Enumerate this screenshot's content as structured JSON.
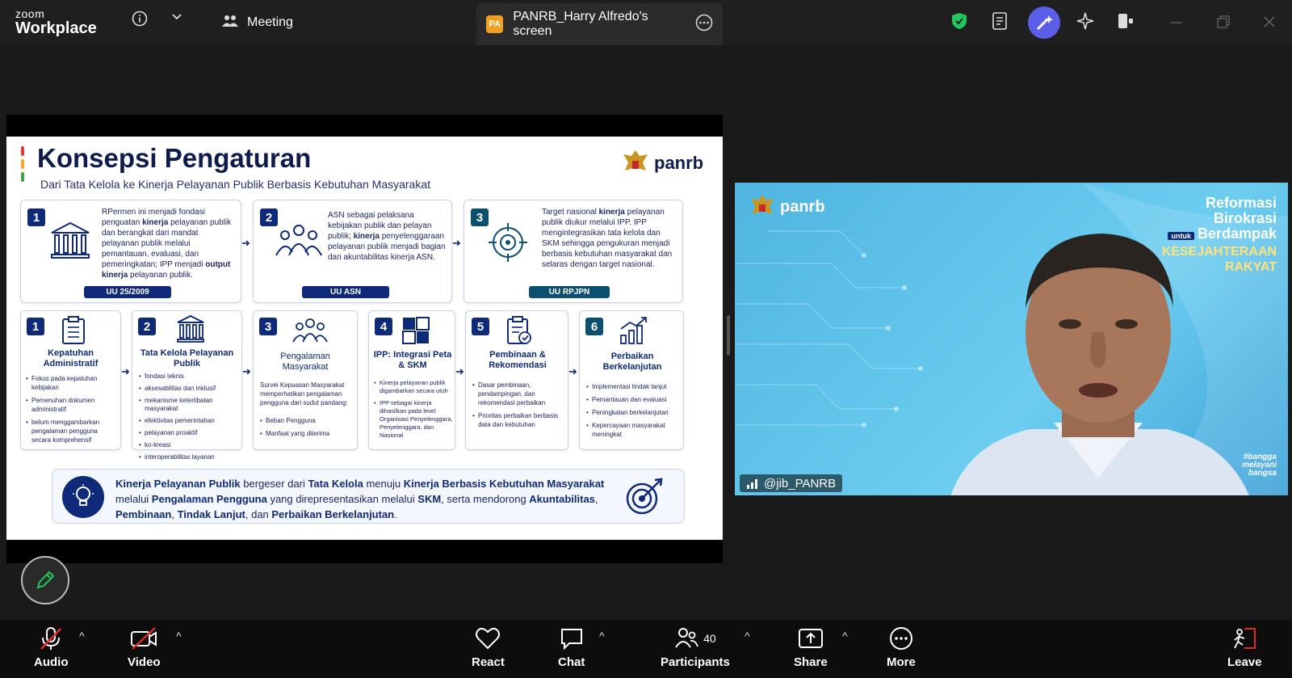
{
  "app": {
    "brand_line1": "zoom",
    "brand_line2": "Workplace"
  },
  "tabs": {
    "meeting_label": "Meeting",
    "share_badge": "PA",
    "share_label": "PANRB_Harry Alfredo's screen"
  },
  "slide": {
    "title": "Konsepsi Pengaturan",
    "subtitle": "Dari Tata Kelola ke Kinerja Pelayanan Publik Berbasis Kebutuhan Masyarakat",
    "logo_text": "panrb",
    "top_boxes": [
      {
        "num": "1",
        "text_html": "RPermen ini menjadi fondasi penguatan <b>kinerja</b> pelayanan publik dan berangkat dari mandat pelayanan publik melalui pemantauan, evaluasi, dan pemeringkatan; IPP menjadi <b>output kinerja</b> pelayanan publik.",
        "tag": "UU 25/2009"
      },
      {
        "num": "2",
        "text_html": "ASN sebagai pelaksana kebijakan publik dan pelayan publik; <b>kinerja</b> penyelenggaraan pelayanan publik menjadi bagian dari akuntabilitas kinerja ASN.",
        "tag": "UU ASN"
      },
      {
        "num": "3",
        "text_html": "Target nasional <b>kinerja</b> pelayanan publik diukur melalui IPP. IPP mengintegrasikan tata kelola dan SKM sehingga pengukuran menjadi berbasis kebutuhan masyarakat dan selaras dengan target nasional.",
        "tag": "UU RPJPN"
      }
    ],
    "steps": [
      {
        "num": "1",
        "title": "Kepatuhan Administratif",
        "items": [
          "Fokus pada kepatuhan kebijakan",
          "Pemenuhan dokumen administratif",
          "belum menggambarkan pengalaman pengguna secara komprehensif"
        ]
      },
      {
        "num": "2",
        "title": "Tata Kelola Pelayanan Publik",
        "items": [
          "fondasi teknis",
          "aksesabilitas dan inklusif",
          "mekanisme keterlibatan masyarakat",
          "efektivitas pemerintahan",
          "pelayanan proaktif",
          "ko-kreasi",
          "interoperabilitas layanan"
        ]
      },
      {
        "num": "3",
        "title": "Pengalaman Masyarakat",
        "intro": "Survei Kepuasan Masyarakat memperhatikan pengalaman pengguna dari sudut pandang:",
        "items": [
          "Beban Pengguna",
          "Manfaat yang diterima"
        ]
      },
      {
        "num": "4",
        "title": "IPP: Integrasi Peta & SKM",
        "items": [
          "Kinerja pelayanan publik digambarkan secara utuh",
          "IPP sebagai kinerja dihasilkan pada level Organisasi Penyelenggara, Penyelenggara, dan Nasional"
        ]
      },
      {
        "num": "5",
        "title": "Pembinaan & Rekomendasi",
        "items": [
          "Dasar pembinaan, pendampingan, dan rekomendasi perbaikan",
          "Prioritas perbaikan berbasis data dan kebutuhan"
        ]
      },
      {
        "num": "6",
        "title": "Perbaikan Berkelanjutan",
        "items": [
          "Implementasi tindak lanjut",
          "Pemantauan dan evaluasi",
          "Peningkatan berkelanjutan",
          "Kepercayaan masyarakat meningkat"
        ]
      }
    ],
    "conclusion_html": "<b>Kinerja Pelayanan Publik</b> bergeser dari <b>Tata Kelola</b> menuju <b>Kinerja Berbasis Kebutuhan Masyarakat</b> melalui <b>Pengalaman Pengguna</b> yang direpresentasikan melalui <b>SKM</b>, serta mendorong <b>Akuntabilitas</b>, <b>Pembinaan</b>, <b>Tindak Lanjut</b>, dan <b>Perbaikan Berkelanjutan</b>."
  },
  "video": {
    "logo_text": "panrb",
    "slogan_line1": "Reformasi",
    "slogan_line2": "Birokrasi",
    "slogan_untuk": "untuk",
    "slogan_line3": "Berdampak",
    "slogan_line4": "KESEJAHTERAAN",
    "slogan_line5": "RAKYAT",
    "hashtag": "#bangga melayani bangsa",
    "participant_name": "@jib_PANRB"
  },
  "toolbar": {
    "audio": "Audio",
    "video": "Video",
    "react": "React",
    "chat": "Chat",
    "participants": "Participants",
    "participants_count": "40",
    "share": "Share",
    "more": "More",
    "leave": "Leave"
  },
  "colors": {
    "topbar": "#1f1f1f",
    "toolbar": "#0d0d0d",
    "slide_navy": "#0e2a78",
    "shield_green": "#22c55e",
    "avatar_purple": "#5b5fe8",
    "leave_red": "#e02828"
  }
}
